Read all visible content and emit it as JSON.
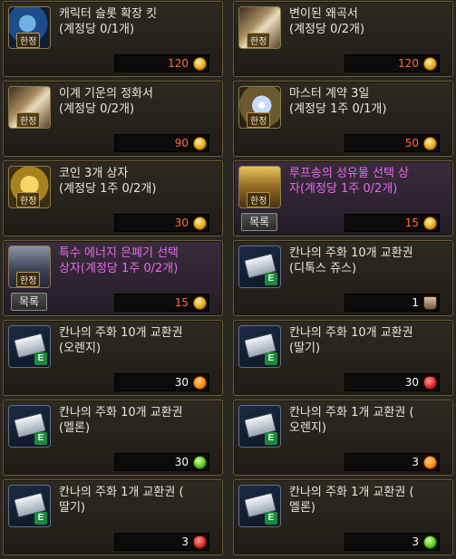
{
  "cards": [
    {
      "title": "캐릭터 슬롯 확장 킷\n(계정당 0/1개)",
      "price": "120",
      "tag": "한정",
      "icon": "character-slot-icon",
      "currency": "gold-coin"
    },
    {
      "title": "변이된 왜곡서\n(계정당 0/2개)",
      "price": "120",
      "tag": "한정",
      "icon": "distortion-scroll-icon",
      "currency": "gold-coin"
    },
    {
      "title": "이계 기운의 정화서\n(계정당 0/2개)",
      "price": "90",
      "tag": "한정",
      "icon": "purification-scroll-icon",
      "currency": "gold-coin"
    },
    {
      "title": "마스터 계약 3일\n(계정당 1주 0/1개)",
      "price": "50",
      "tag": "한정",
      "icon": "master-contract-icon",
      "currency": "gold-coin"
    },
    {
      "title": "코인 3개 상자\n(계정당 1주 0/2개)",
      "price": "30",
      "tag": "한정",
      "icon": "coin-box-icon",
      "currency": "gold-coin"
    },
    {
      "title": "루프송의 성유물 선택 상\n자(계정당 1주 0/2개)",
      "price": "15",
      "tag": "한정",
      "button": "목록",
      "icon": "relic-box-icon",
      "currency": "gold-coin"
    },
    {
      "title": "특수 에너지 은폐기 선택\n상자(계정당 1주 0/2개)",
      "price": "15",
      "tag": "한정",
      "button": "목록",
      "icon": "energy-box-icon",
      "currency": "gold-coin"
    },
    {
      "title": "칸나의 주화 10개 교환권\n(디톡스 쥬스)",
      "price": "1",
      "icon": "exchange-ticket-icon",
      "currency": "juice-cup"
    },
    {
      "title": "칸나의 주화 10개 교환권\n(오렌지)",
      "price": "30",
      "icon": "exchange-ticket-icon",
      "currency": "orange"
    },
    {
      "title": "칸나의 주화 10개 교환권\n(딸기)",
      "price": "30",
      "icon": "exchange-ticket-icon",
      "currency": "strawberry"
    },
    {
      "title": "칸나의 주화 10개 교환권\n(멜론)",
      "price": "30",
      "icon": "exchange-ticket-icon",
      "currency": "melon"
    },
    {
      "title": "칸나의 주화 1개 교환권 (\n오렌지)",
      "price": "3",
      "icon": "exchange-ticket-icon",
      "currency": "orange"
    },
    {
      "title": "칸나의 주화 1개 교환권 (\n딸기)",
      "price": "3",
      "icon": "exchange-ticket-icon",
      "currency": "strawberry"
    },
    {
      "title": "칸나의 주화 1개 교환권 (\n멜론)",
      "price": "3",
      "icon": "exchange-ticket-icon",
      "currency": "melon"
    }
  ]
}
